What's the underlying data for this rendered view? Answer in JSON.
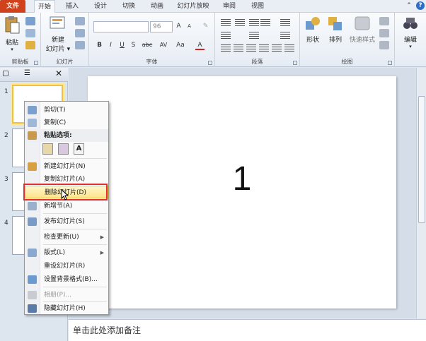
{
  "tabs": [
    "文件",
    "开始",
    "插入",
    "设计",
    "切换",
    "动画",
    "幻灯片放映",
    "审阅",
    "视图"
  ],
  "ribbon": {
    "clipboard": {
      "paste": "粘贴",
      "label": "剪贴板"
    },
    "slides": {
      "new_slide_line1": "新建",
      "new_slide_line2": "幻灯片 ▾",
      "label": "幻灯片"
    },
    "font": {
      "size": "96",
      "label": "字体",
      "bold": "B",
      "italic": "I",
      "underline": "U",
      "strike": "S",
      "shadow": "abc",
      "spacing": "AV",
      "case": "Aa",
      "color": "A",
      "grow": "A",
      "shrink": "A"
    },
    "paragraph": {
      "label": "段落"
    },
    "drawing": {
      "shapes": "形状",
      "arrange": "排列",
      "quick_styles": "快速样式",
      "label": "绘图"
    },
    "editing": {
      "label": "编辑"
    }
  },
  "thumbnails": [
    "1",
    "2",
    "3",
    "4"
  ],
  "slide": {
    "number": "1"
  },
  "notes": {
    "placeholder": "单击此处添加备注"
  },
  "context_menu": {
    "cut": "剪切(T)",
    "copy": "复制(C)",
    "paste_options": "粘贴选项:",
    "new_slide": "新建幻灯片(N)",
    "duplicate_slide": "复制幻灯片(A)",
    "delete_slide": "删除幻灯片(D)",
    "add_section": "新增节(A)",
    "publish_slides": "发布幻灯片(S)",
    "check_updates": "检查更新(U)",
    "layout": "版式(L)",
    "reset_slide": "重设幻灯片(R)",
    "format_background": "设置背景格式(B)...",
    "photo_album": "相册(P)...",
    "hide_slide": "隐藏幻灯片(H)",
    "paste_letter": "A"
  },
  "colors": {
    "file_tab": "#d0421b",
    "highlight": "#fde58a",
    "redbox": "#e03030"
  }
}
